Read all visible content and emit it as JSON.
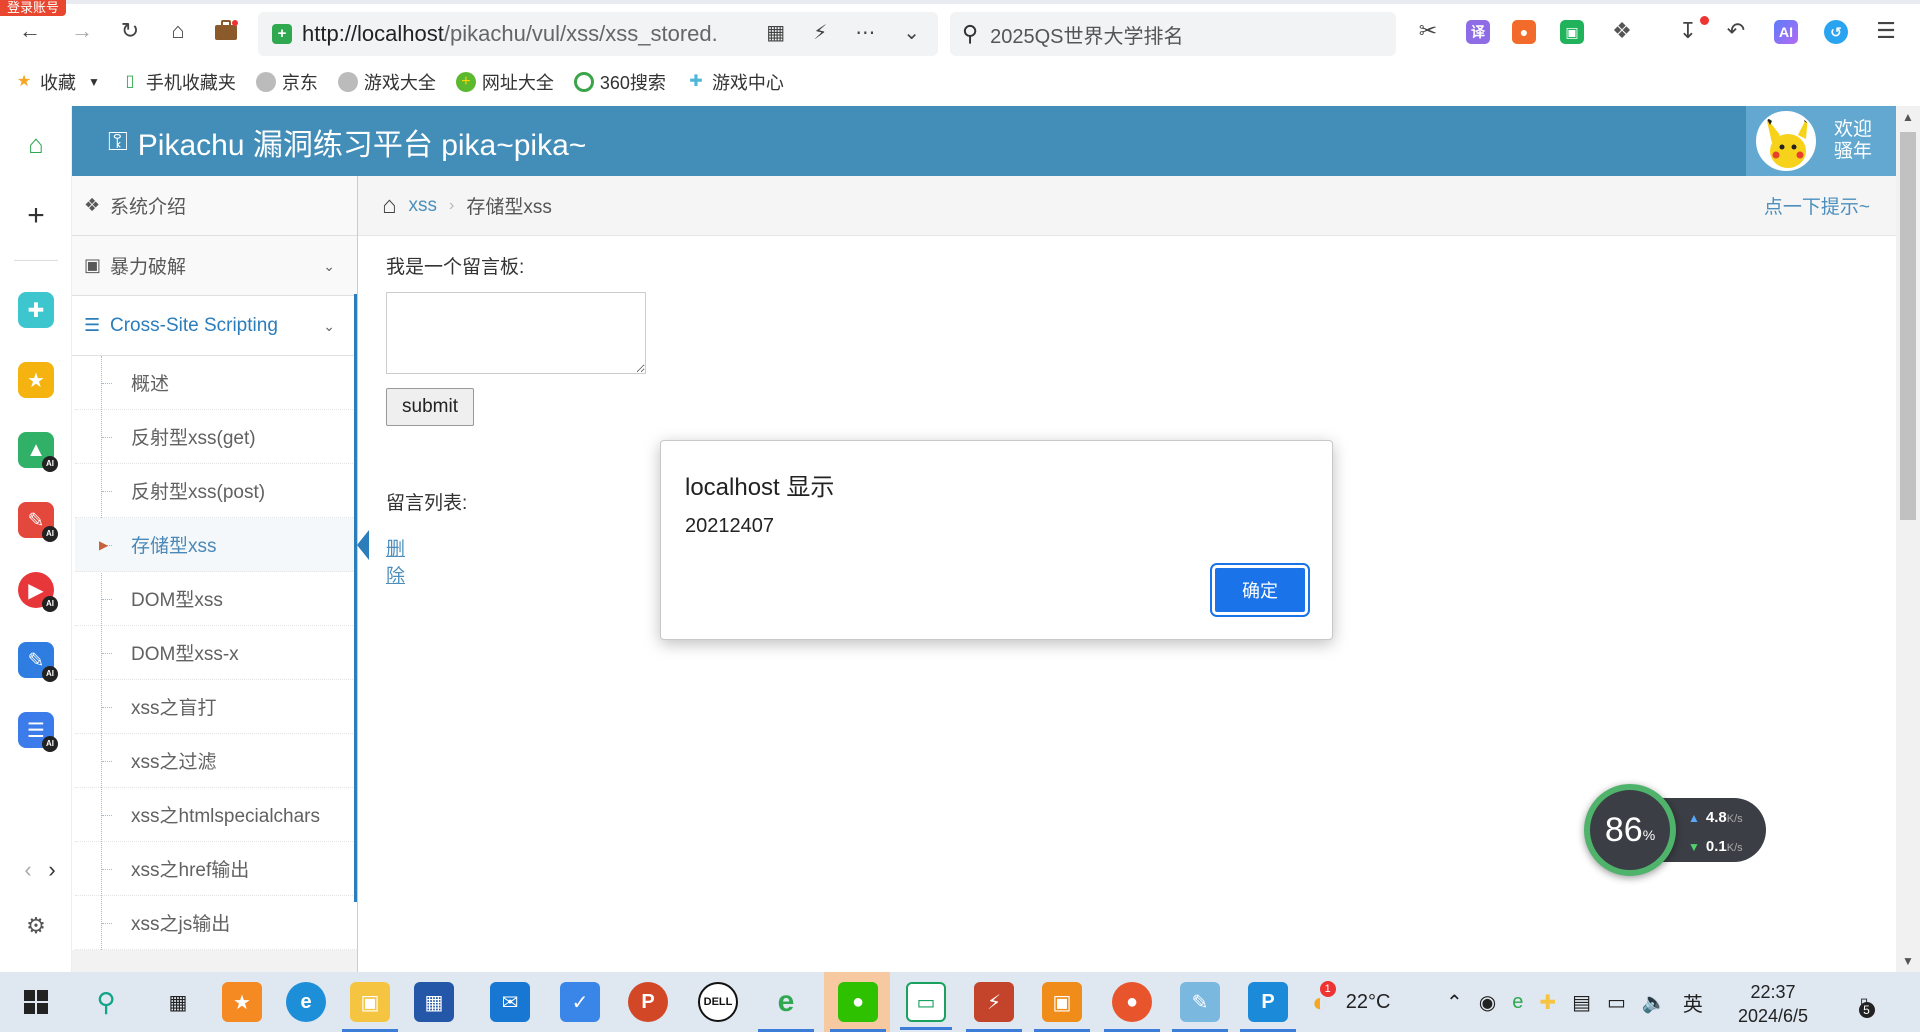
{
  "browser": {
    "login_badge": "登录账号",
    "url_host": "http://localhost",
    "url_path": "/pikachu/vul/xss/xss_stored.",
    "search_text": "2025QS世界大学排名",
    "bookmarks": [
      {
        "label": "收藏",
        "icon": "star-icon"
      },
      {
        "label": "手机收藏夹",
        "icon": "phone-icon"
      },
      {
        "label": "京东",
        "icon": "globe-icon"
      },
      {
        "label": "游戏大全",
        "icon": "globe-icon"
      },
      {
        "label": "网址大全",
        "icon": "plus-circle-icon"
      },
      {
        "label": "360搜索",
        "icon": "360-icon"
      },
      {
        "label": "游戏中心",
        "icon": "game-icon"
      }
    ]
  },
  "app": {
    "title": "Pikachu 漏洞练习平台 pika~pika~",
    "welcome_line1": "欢迎",
    "welcome_line2": "骚年"
  },
  "sidebar": {
    "sections": [
      {
        "label": "系统介绍"
      },
      {
        "label": "暴力破解"
      },
      {
        "label": "Cross-Site Scripting"
      }
    ],
    "xss_items": [
      {
        "label": "概述"
      },
      {
        "label": "反射型xss(get)"
      },
      {
        "label": "反射型xss(post)"
      },
      {
        "label": "存储型xss"
      },
      {
        "label": "DOM型xss"
      },
      {
        "label": "DOM型xss-x"
      },
      {
        "label": "xss之盲打"
      },
      {
        "label": "xss之过滤"
      },
      {
        "label": "xss之htmlspecialchars"
      },
      {
        "label": "xss之href输出"
      },
      {
        "label": "xss之js输出"
      }
    ]
  },
  "breadcrumb": {
    "parent": "xss",
    "current": "存储型xss",
    "hint": "点一下提示~"
  },
  "main": {
    "board_label": "我是一个留言板:",
    "textarea_value": "",
    "submit_label": "submit",
    "list_label": "留言列表:",
    "delete_label": "删除"
  },
  "dialog": {
    "title": "localhost 显示",
    "message": "20212407",
    "ok_label": "确定"
  },
  "speed_widget": {
    "percent": "86",
    "percent_unit": "%",
    "up": "4.8",
    "down": "0.1",
    "unit": "K/s"
  },
  "taskbar": {
    "weather": "22°C",
    "ime": "英",
    "time": "22:37",
    "date": "2024/6/5",
    "notifications": "5",
    "badge": "1"
  },
  "colors": {
    "navbar": "#438eb9",
    "accent": "#2b7dbc",
    "link": "#4c8fbd",
    "dialog_button": "#1a73e8"
  }
}
